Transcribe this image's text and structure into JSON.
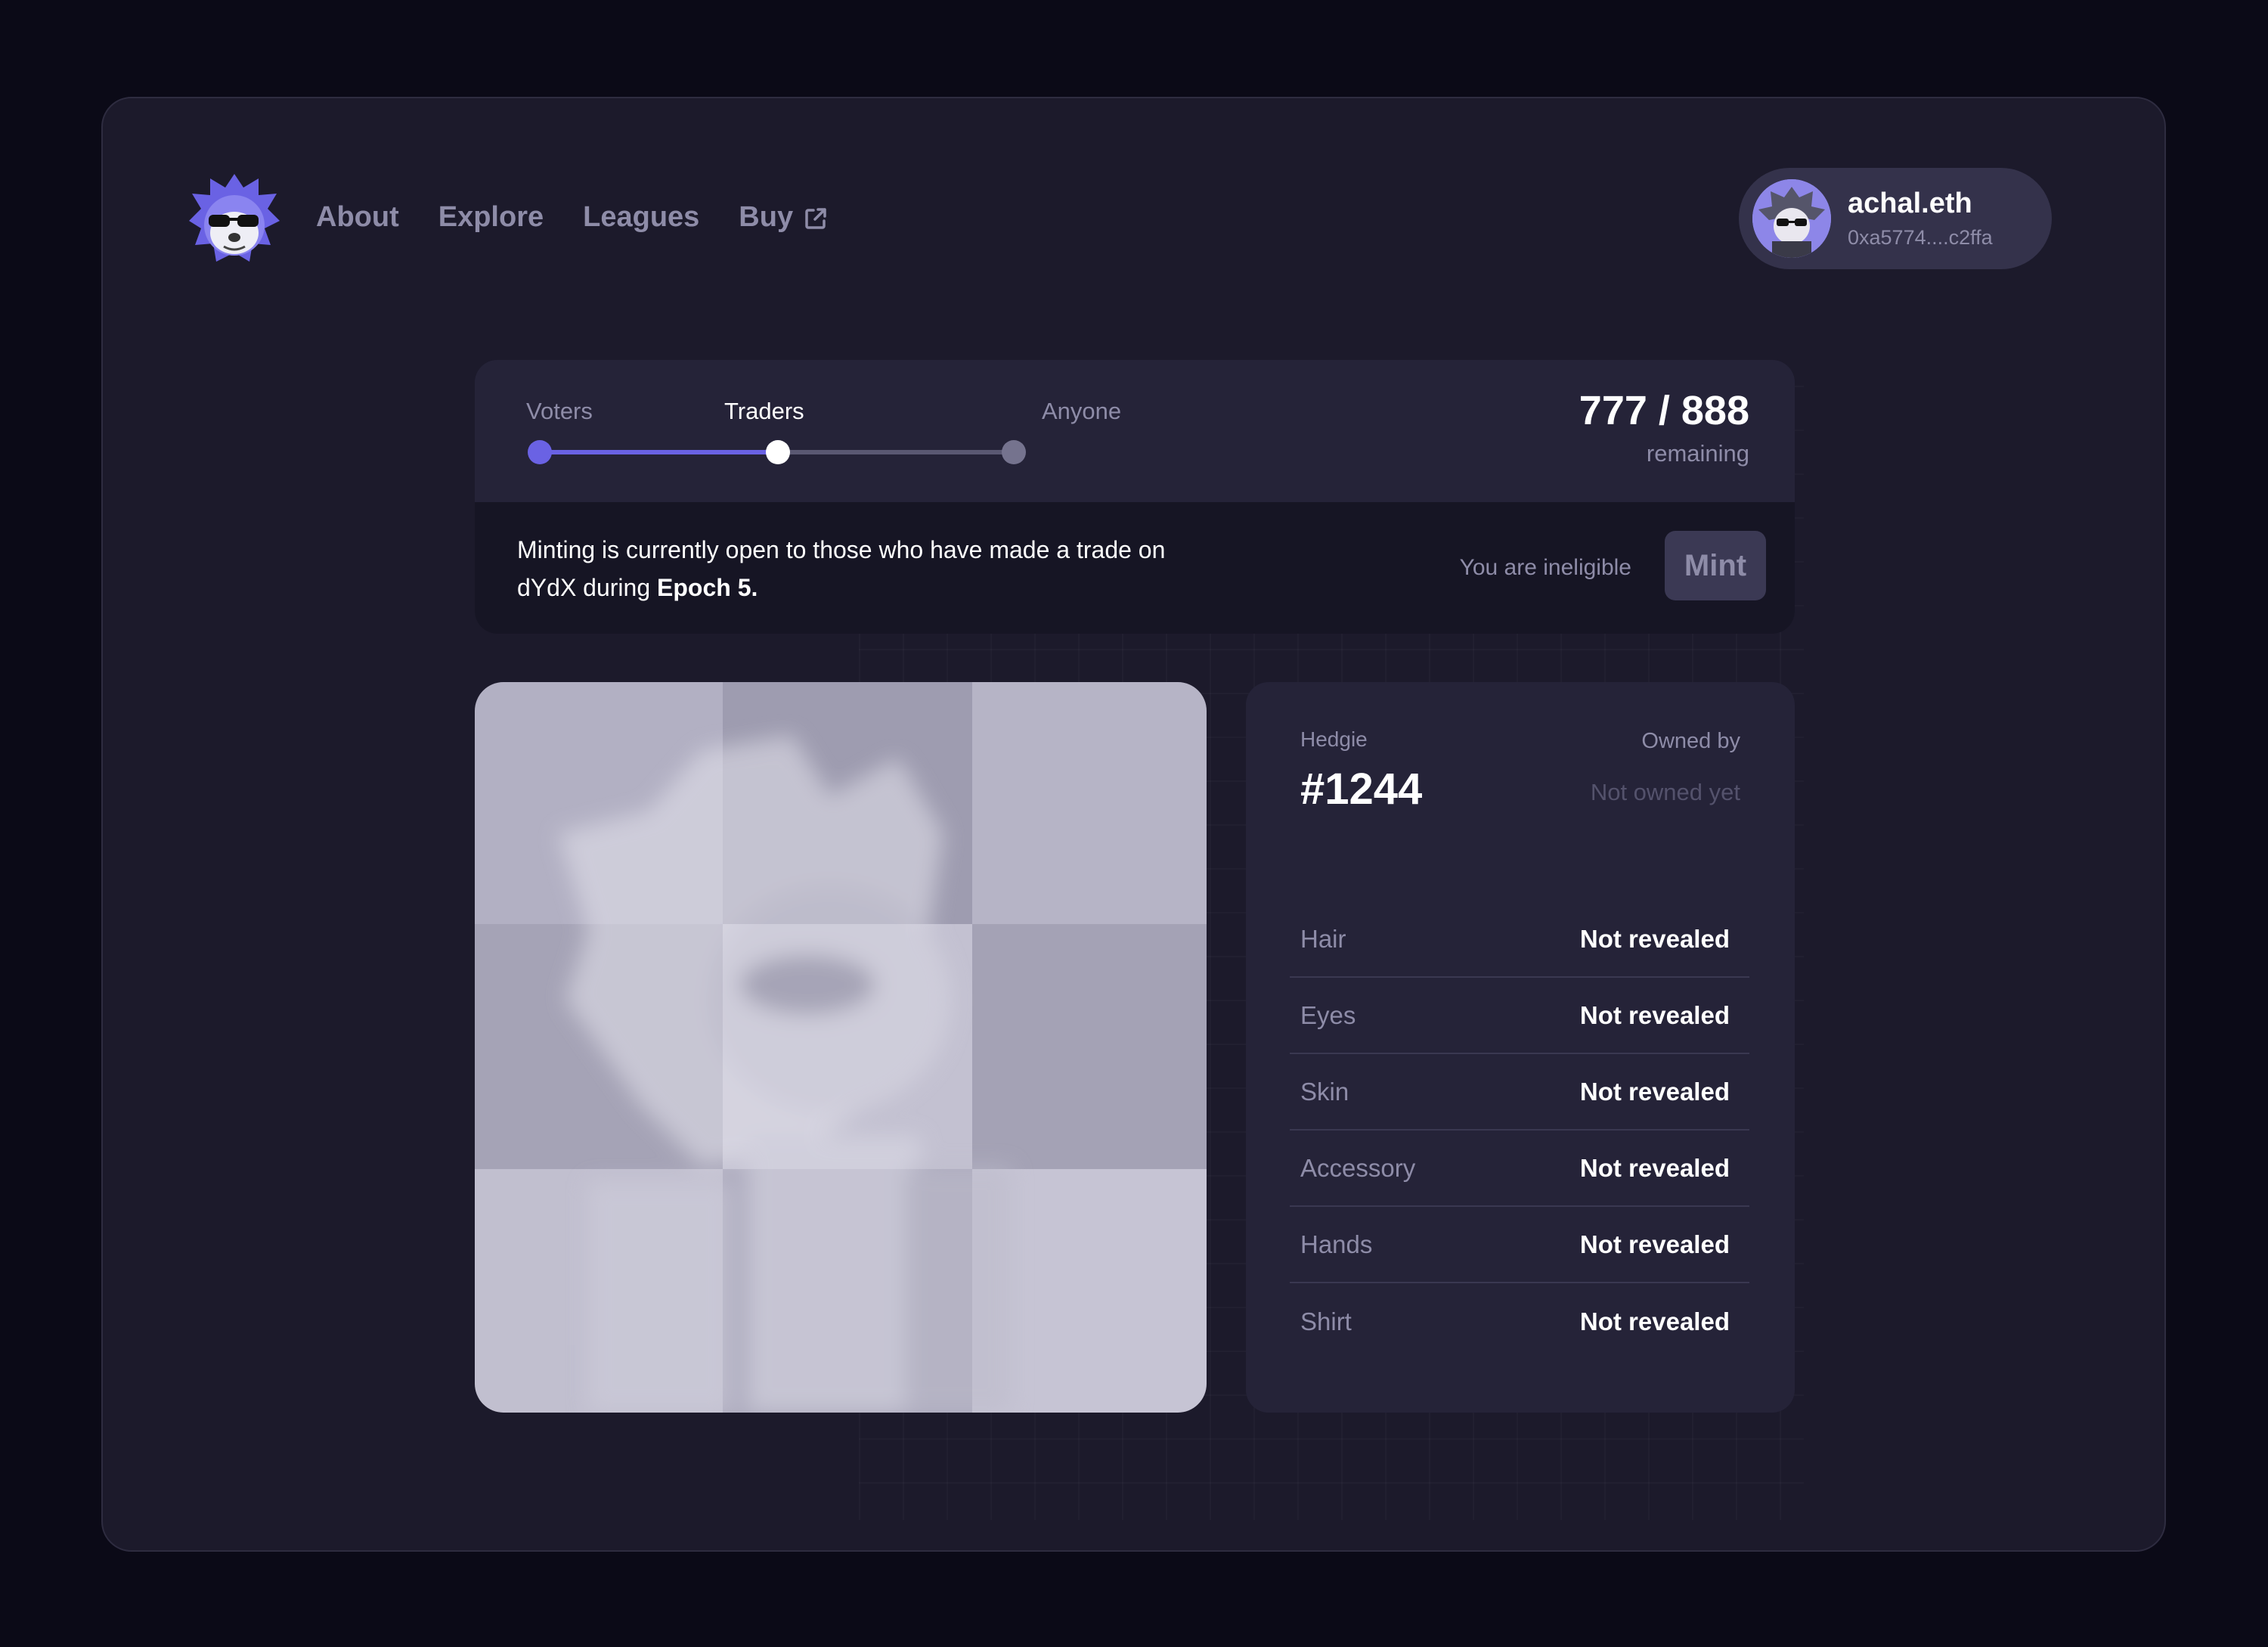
{
  "nav": {
    "items": [
      {
        "label": "About"
      },
      {
        "label": "Explore"
      },
      {
        "label": "Leagues"
      },
      {
        "label": "Buy"
      }
    ]
  },
  "account": {
    "name": "achal.eth",
    "address": "0xa5774....c2ffa"
  },
  "mint": {
    "phases": [
      "Voters",
      "Traders",
      "Anyone"
    ],
    "current_phase_index": 1,
    "count": "777 / 888",
    "count_label": "remaining",
    "message_text": "Minting is currently open to those who have made a trade on dYdX during ",
    "message_bold": "Epoch 5.",
    "eligibility": "You are ineligible",
    "button_label": "Mint"
  },
  "hedgie": {
    "label": "Hedgie",
    "id": "#1244",
    "owned_by_label": "Owned by",
    "owner": "Not owned yet",
    "traits": [
      {
        "name": "Hair",
        "value": "Not revealed"
      },
      {
        "name": "Eyes",
        "value": "Not revealed"
      },
      {
        "name": "Skin",
        "value": "Not revealed"
      },
      {
        "name": "Accessory",
        "value": "Not revealed"
      },
      {
        "name": "Hands",
        "value": "Not revealed"
      },
      {
        "name": "Shirt",
        "value": "Not revealed"
      }
    ]
  },
  "colors": {
    "accent": "#6a62e4",
    "background": "#0b0a17",
    "window": "#1c1a2b",
    "panel": "#252338"
  }
}
